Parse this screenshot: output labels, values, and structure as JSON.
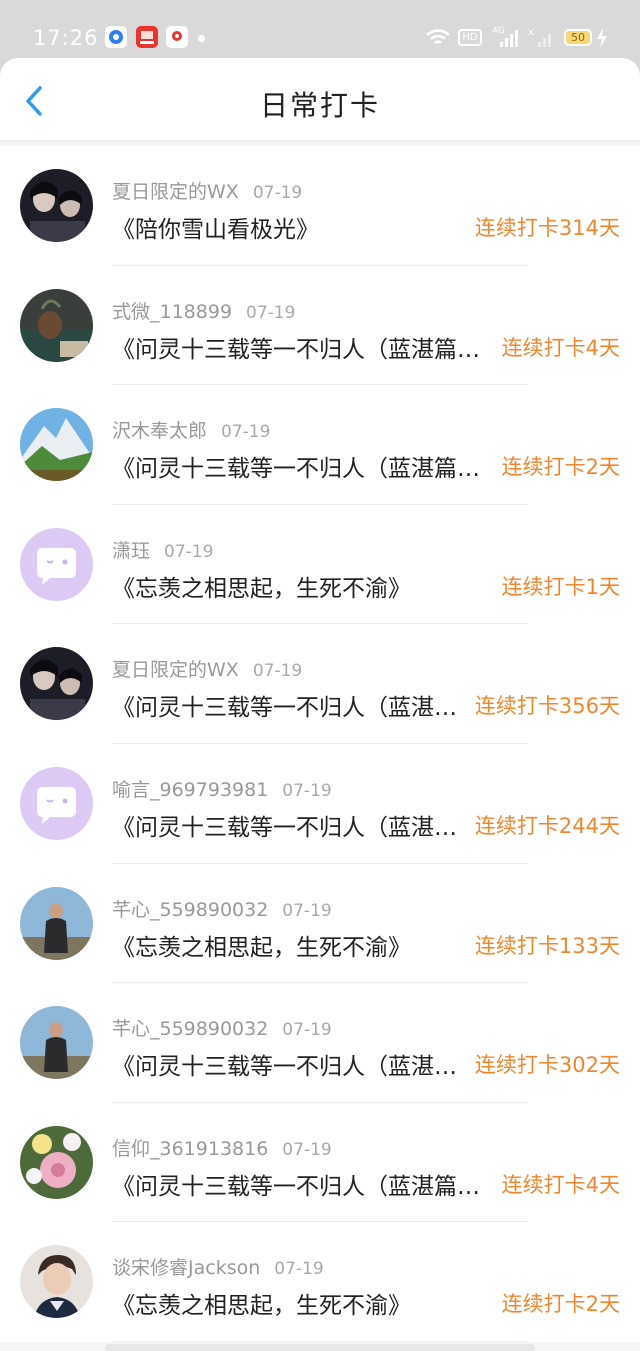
{
  "status_bar": {
    "time": "17:26",
    "icons": [
      "browser-app-icon",
      "shopping-app-icon",
      "map-app-icon",
      "notification-dot",
      "wifi-icon",
      "hd-icon",
      "signal-4g-icon",
      "signal-x-icon",
      "battery-icon",
      "charging-icon"
    ],
    "hd_label": "HD",
    "network_label": "4G",
    "battery_level": "50"
  },
  "nav": {
    "back_icon": "chevron-left-icon",
    "title": "日常打卡",
    "accent_color": "#2b9af3"
  },
  "checkins": [
    {
      "user": "夏日限定的WX",
      "date": "07-19",
      "book": "《陪你雪山看极光》",
      "streak": "连续打卡314天",
      "avatar": "dark-photo-avatar"
    },
    {
      "user": "式微_118899",
      "date": "07-19",
      "book": "《问灵十三载等一不归人（蓝湛篇…",
      "streak": "连续打卡4天",
      "avatar": "vase-photo-avatar"
    },
    {
      "user": "沢木奉太郎",
      "date": "07-19",
      "book": "《问灵十三载等一不归人（蓝湛篇…",
      "streak": "连续打卡2天",
      "avatar": "mountain-photo-avatar"
    },
    {
      "user": "潇珏",
      "date": "07-19",
      "book": "《忘羡之相思起，生死不渝》",
      "streak": "连续打卡1天",
      "avatar": "default-chat-avatar"
    },
    {
      "user": "夏日限定的WX",
      "date": "07-19",
      "book": "《问灵十三载等一不归人（蓝湛…",
      "streak": "连续打卡356天",
      "avatar": "dark-photo-avatar"
    },
    {
      "user": "喻言_969793981",
      "date": "07-19",
      "book": "《问灵十三载等一不归人（蓝湛…",
      "streak": "连续打卡244天",
      "avatar": "default-chat-avatar"
    },
    {
      "user": "芊心_559890032",
      "date": "07-19",
      "book": "《忘羡之相思起，生死不渝》",
      "streak": "连续打卡133天",
      "avatar": "person-photo-avatar"
    },
    {
      "user": "芊心_559890032",
      "date": "07-19",
      "book": "《问灵十三载等一不归人（蓝湛…",
      "streak": "连续打卡302天",
      "avatar": "person-photo-avatar"
    },
    {
      "user": "信仰_361913816",
      "date": "07-19",
      "book": "《问灵十三载等一不归人（蓝湛篇…",
      "streak": "连续打卡4天",
      "avatar": "flower-photo-avatar"
    },
    {
      "user": "谈宋修睿Jackson",
      "date": "07-19",
      "book": "《忘羡之相思起，生死不渝》",
      "streak": "连续打卡2天",
      "avatar": "boy-photo-avatar"
    }
  ],
  "colors": {
    "streak": "#f0862e",
    "username": "#999999",
    "book_title": "#222222",
    "default_avatar_bg": "#d9c7f3"
  }
}
